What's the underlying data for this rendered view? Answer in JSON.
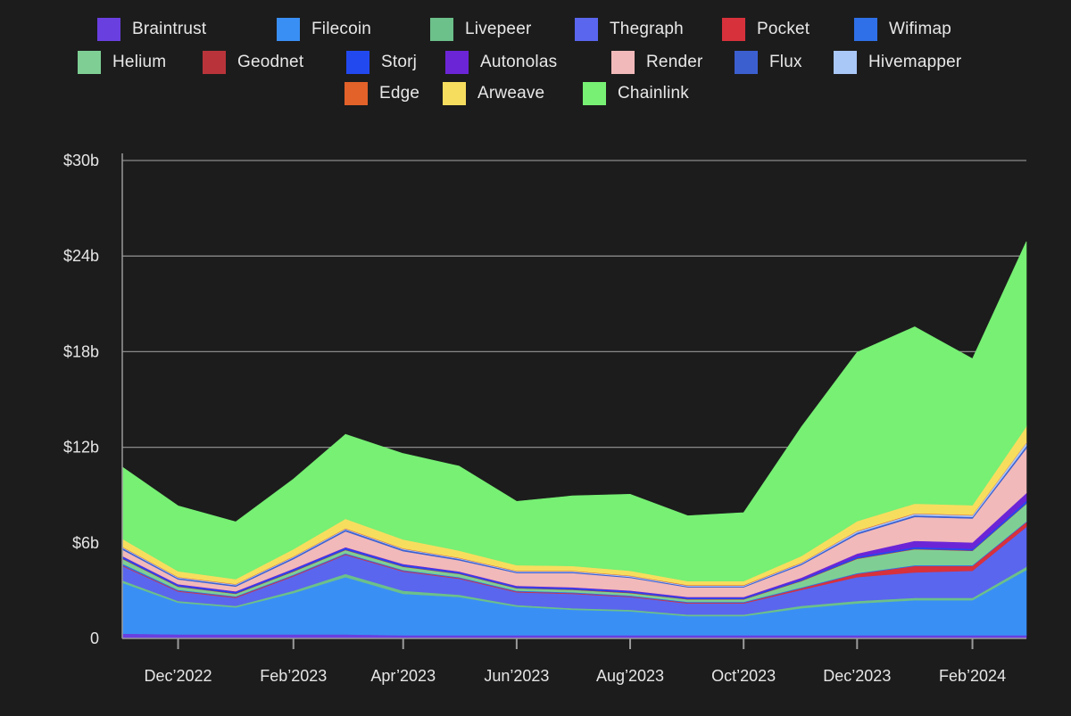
{
  "chart_data": {
    "type": "area",
    "stacked": true,
    "title": "",
    "xlabel": "",
    "ylabel": "",
    "unit": "USD billions",
    "ylim": [
      0,
      30
    ],
    "y_ticks": [
      {
        "value": 0,
        "label": "0"
      },
      {
        "value": 6,
        "label": "$6b"
      },
      {
        "value": 12,
        "label": "$12b"
      },
      {
        "value": 18,
        "label": "$18b"
      },
      {
        "value": 24,
        "label": "$24b"
      },
      {
        "value": 30,
        "label": "$30b"
      }
    ],
    "xlim": [
      "2022-11-01",
      "2024-03-01"
    ],
    "x_ticks": [
      {
        "date": "2022-12-01",
        "label": "Dec’2022"
      },
      {
        "date": "2023-02-01",
        "label": "Feb’2023"
      },
      {
        "date": "2023-04-01",
        "label": "Apr’2023"
      },
      {
        "date": "2023-06-01",
        "label": "Jun’2023"
      },
      {
        "date": "2023-08-01",
        "label": "Aug’2023"
      },
      {
        "date": "2023-10-01",
        "label": "Oct’2023"
      },
      {
        "date": "2023-12-01",
        "label": "Dec’2023"
      },
      {
        "date": "2024-02-01",
        "label": "Feb’2024"
      }
    ],
    "grid": "horizontal",
    "legend_position": "top",
    "x": [
      "2022-11-01",
      "2022-12-01",
      "2023-01-01",
      "2023-02-01",
      "2023-03-01",
      "2023-04-01",
      "2023-05-01",
      "2023-06-01",
      "2023-07-01",
      "2023-08-01",
      "2023-09-01",
      "2023-10-01",
      "2023-11-01",
      "2023-12-01",
      "2024-01-01",
      "2024-02-01",
      "2024-03-01"
    ],
    "series": [
      {
        "name": "Braintrust",
        "color": "#6a3fe0",
        "values": [
          0.3,
          0.25,
          0.25,
          0.25,
          0.25,
          0.2,
          0.2,
          0.2,
          0.2,
          0.2,
          0.2,
          0.2,
          0.2,
          0.2,
          0.2,
          0.2,
          0.2
        ]
      },
      {
        "name": "Filecoin",
        "color": "#3a8ff5",
        "values": [
          3.2,
          2.0,
          1.7,
          2.6,
          3.6,
          2.6,
          2.4,
          1.8,
          1.6,
          1.5,
          1.2,
          1.2,
          1.7,
          2.0,
          2.2,
          2.2,
          4.1
        ]
      },
      {
        "name": "Livepeer",
        "color": "#6cc08a",
        "values": [
          0.15,
          0.1,
          0.1,
          0.15,
          0.2,
          0.2,
          0.15,
          0.1,
          0.1,
          0.1,
          0.1,
          0.1,
          0.15,
          0.15,
          0.15,
          0.15,
          0.2
        ]
      },
      {
        "name": "Thegraph",
        "color": "#5a66ee",
        "values": [
          0.9,
          0.6,
          0.5,
          0.9,
          1.2,
          1.2,
          1.0,
          0.8,
          0.9,
          0.8,
          0.7,
          0.7,
          1.0,
          1.5,
          1.6,
          1.7,
          2.5
        ]
      },
      {
        "name": "Pocket",
        "color": "#d7313c",
        "values": [
          0.05,
          0.05,
          0.05,
          0.05,
          0.05,
          0.05,
          0.05,
          0.05,
          0.05,
          0.05,
          0.05,
          0.05,
          0.1,
          0.2,
          0.4,
          0.3,
          0.3
        ]
      },
      {
        "name": "Wifimap",
        "color": "#2f70e8",
        "values": [
          0.1,
          0.05,
          0.05,
          0.05,
          0.05,
          0.05,
          0.05,
          0.05,
          0.05,
          0.05,
          0.05,
          0.05,
          0.05,
          0.05,
          0.05,
          0.05,
          0.05
        ]
      },
      {
        "name": "Helium",
        "color": "#7fcf94",
        "values": [
          0.3,
          0.2,
          0.15,
          0.2,
          0.2,
          0.2,
          0.2,
          0.15,
          0.15,
          0.15,
          0.15,
          0.15,
          0.4,
          0.9,
          1.0,
          0.9,
          1.1
        ]
      },
      {
        "name": "Geodnet",
        "color": "#b8343a",
        "values": [
          0.03,
          0.03,
          0.03,
          0.03,
          0.03,
          0.03,
          0.03,
          0.03,
          0.03,
          0.03,
          0.03,
          0.03,
          0.03,
          0.03,
          0.03,
          0.03,
          0.03
        ]
      },
      {
        "name": "Storj",
        "color": "#2249f0",
        "values": [
          0.1,
          0.08,
          0.08,
          0.1,
          0.1,
          0.1,
          0.08,
          0.08,
          0.08,
          0.08,
          0.08,
          0.08,
          0.08,
          0.1,
          0.1,
          0.1,
          0.15
        ]
      },
      {
        "name": "Autonolas",
        "color": "#6c25d6",
        "values": [
          0.05,
          0.05,
          0.05,
          0.05,
          0.05,
          0.05,
          0.05,
          0.05,
          0.05,
          0.05,
          0.05,
          0.05,
          0.1,
          0.2,
          0.4,
          0.4,
          0.5
        ]
      },
      {
        "name": "Render",
        "color": "#f1b9b9",
        "values": [
          0.4,
          0.3,
          0.3,
          0.6,
          1.0,
          0.8,
          0.7,
          0.8,
          0.9,
          0.8,
          0.6,
          0.6,
          0.8,
          1.2,
          1.5,
          1.5,
          2.8
        ]
      },
      {
        "name": "Flux",
        "color": "#3c5fd0",
        "values": [
          0.1,
          0.08,
          0.08,
          0.1,
          0.1,
          0.1,
          0.08,
          0.06,
          0.06,
          0.06,
          0.06,
          0.06,
          0.08,
          0.1,
          0.1,
          0.1,
          0.15
        ]
      },
      {
        "name": "Hivemapper",
        "color": "#a9c7f7",
        "values": [
          0.05,
          0.05,
          0.05,
          0.05,
          0.05,
          0.05,
          0.05,
          0.05,
          0.05,
          0.05,
          0.05,
          0.05,
          0.05,
          0.1,
          0.1,
          0.1,
          0.2
        ]
      },
      {
        "name": "Edge",
        "color": "#e2622a",
        "values": [
          0.03,
          0.03,
          0.03,
          0.03,
          0.03,
          0.03,
          0.03,
          0.03,
          0.03,
          0.03,
          0.03,
          0.03,
          0.03,
          0.03,
          0.03,
          0.03,
          0.03
        ]
      },
      {
        "name": "Arweave",
        "color": "#f7dd5e",
        "values": [
          0.5,
          0.35,
          0.3,
          0.45,
          0.6,
          0.55,
          0.45,
          0.35,
          0.3,
          0.3,
          0.25,
          0.25,
          0.4,
          0.6,
          0.6,
          0.6,
          1.0
        ]
      },
      {
        "name": "Chainlink",
        "color": "#77f074",
        "values": [
          4.5,
          4.1,
          3.6,
          4.4,
          5.3,
          5.4,
          5.3,
          4.0,
          4.4,
          4.8,
          4.1,
          4.3,
          8.1,
          10.6,
          11.1,
          9.2,
          11.6
        ]
      }
    ]
  }
}
